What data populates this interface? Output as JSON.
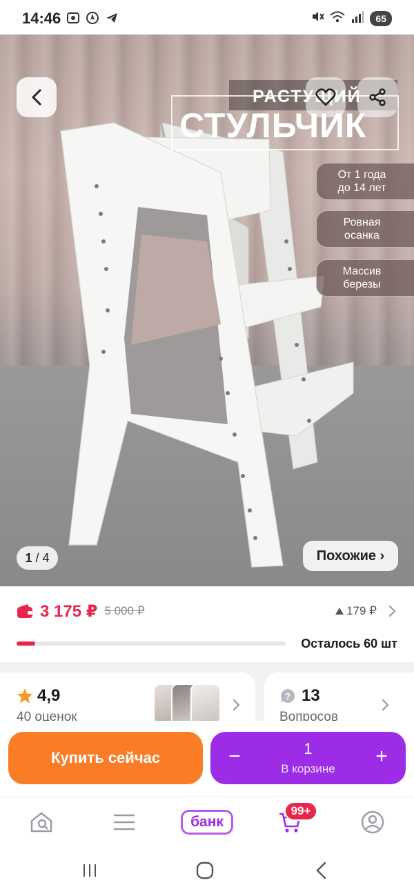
{
  "status_bar": {
    "time": "14:46",
    "battery": "65"
  },
  "hero": {
    "promo_line1": "РАСТУЩИЙ",
    "promo_line2": "СТУЛЬЧИК",
    "features": [
      {
        "line1": "От 1 года",
        "line2": "до 14 лет"
      },
      {
        "line1": "Ровная",
        "line2": "осанка"
      },
      {
        "line1": "Массив",
        "line2": "березы"
      }
    ],
    "counter_current": "1",
    "counter_total": "/ 4",
    "similar_label": "Похожие ›"
  },
  "price": {
    "current": "3 175 ₽",
    "old": "5 000 ₽",
    "delta": "179 ₽",
    "stock_label": "Осталось 60 шт",
    "stock_fraction": 0.07,
    "accent_color": "#e8264b"
  },
  "rating": {
    "value": "4,9",
    "count": "40 оценок"
  },
  "questions": {
    "value": "13",
    "label": "Вопросов"
  },
  "buy": {
    "buy_now": "Купить сейчас",
    "minus": "−",
    "plus": "+",
    "qty": "1",
    "in_cart": "В корзине",
    "buy_color": "#fb7c26",
    "cart_color": "#9c2ce6"
  },
  "bottom_nav": {
    "home_icon": "home-search-icon",
    "catalog_icon": "menu-icon",
    "bank_label": "банк",
    "cart_badge": "99+",
    "profile_icon": "profile-icon"
  }
}
